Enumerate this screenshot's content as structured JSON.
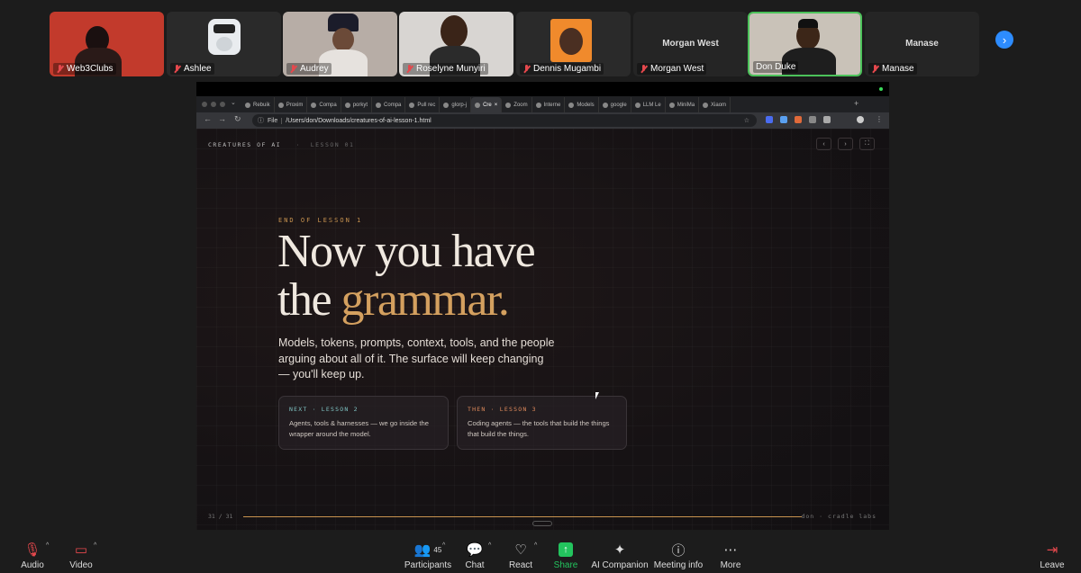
{
  "participants": [
    {
      "name": "Web3Clubs",
      "muted": true
    },
    {
      "name": "Ashlee",
      "muted": true
    },
    {
      "name": "Audrey",
      "muted": true
    },
    {
      "name": "Roselyne Munyiri",
      "muted": true
    },
    {
      "name": "Dennis Mugambi",
      "muted": true
    },
    {
      "name": "Morgan West",
      "muted": true,
      "center": "Morgan West"
    },
    {
      "name": "Don Duke",
      "muted": false
    },
    {
      "name": "Manase",
      "muted": true,
      "center": "Manase"
    }
  ],
  "browser": {
    "tabs": [
      "Rebuik",
      "Proxim",
      "Compa",
      "porkyt",
      "Compa",
      "Pull rec",
      "glorp-j",
      "Cre",
      "Zoom",
      "Interne",
      "Models",
      "google",
      "LLM Le",
      "MiniMa",
      "Xiaom"
    ],
    "active_tab_index": 7,
    "url_scheme": "File",
    "url": "/Users/don/Downloads/creatures-of-ai-lesson-1.html"
  },
  "slide": {
    "brand": "CREATURES OF AI",
    "separator": "·",
    "lesson_tag": "LESSON 01",
    "nav_prev": "‹",
    "nav_next": "›",
    "nav_fullscreen": "⛶",
    "eyebrow": "END OF LESSON 1",
    "headline_line1": "Now you have",
    "headline_line2_plain": "the ",
    "headline_line2_accent": "grammar.",
    "subtitle": "Models, tokens, prompts, context, tools, and the people arguing about all of it. The surface will keep changing — you'll keep up.",
    "cards": [
      {
        "label": "NEXT · LESSON 2",
        "text": "Agents, tools & harnesses — we go inside the wrapper around the model.",
        "color": "#7fc4c4"
      },
      {
        "label": "THEN · LESSON 3",
        "text": "Coding agents — the tools that build the things that build the things.",
        "color": "#e08a5c"
      }
    ],
    "page_counter": "31 / 31",
    "progress": 1.0,
    "credit": "don · cradle labs"
  },
  "controls": {
    "audio": "Audio",
    "video": "Video",
    "participants": "Participants",
    "participants_count": "45",
    "chat": "Chat",
    "react": "React",
    "share": "Share",
    "ai_companion": "AI Companion",
    "meeting_info": "Meeting info",
    "more": "More",
    "leave": "Leave"
  },
  "colors": {
    "accent_gold": "#d4a05f",
    "zoom_blue": "#2d8cff",
    "share_green": "#23c45e",
    "active_speaker": "#4cc25a"
  }
}
